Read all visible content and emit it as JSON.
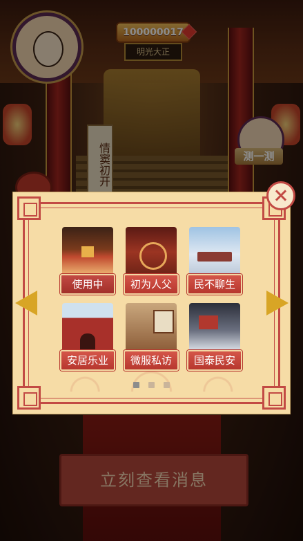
{
  "hud": {
    "coins": "100000017",
    "hall_plaque": "明光大正",
    "banner": "情窦初开",
    "test_label": "测一测"
  },
  "bottom_button": "立刻查看消息",
  "dialog": {
    "scenes": [
      {
        "label": "使用中",
        "icon": "throne-hall-scene"
      },
      {
        "label": "初为人父",
        "icon": "dragon-throne-scene"
      },
      {
        "label": "民不聊生",
        "icon": "snow-palace-scene"
      },
      {
        "label": "安居乐业",
        "icon": "palace-gate-scene"
      },
      {
        "label": "微服私访",
        "icon": "inner-chamber-scene"
      },
      {
        "label": "国泰民安",
        "icon": "night-snow-scene"
      }
    ],
    "page_count": 3,
    "current_page": 1
  },
  "colors": {
    "frame_red": "#c24a44",
    "paper": "#f6dca6",
    "arrow_gold": "#d8a525"
  }
}
